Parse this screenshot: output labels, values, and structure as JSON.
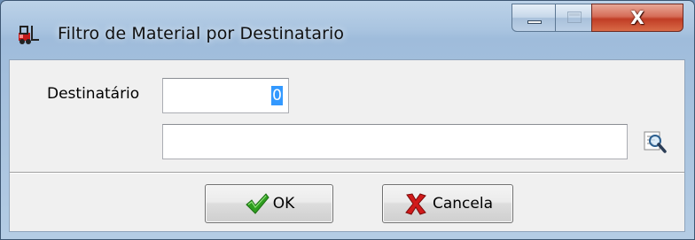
{
  "window": {
    "title": "Filtro de Material por Destinatario",
    "app_icon": "forklift-icon",
    "caption_buttons": {
      "minimize_icon": "minimize-icon",
      "maximize_icon": "maximize-icon",
      "close_label": "X"
    }
  },
  "form": {
    "destinatario_label": "Destinatário",
    "destinatario_code_value": "0",
    "destinatario_name_value": "",
    "search_icon": "magnifier-search-icon"
  },
  "buttons": {
    "ok_label": "OK",
    "ok_icon": "check-icon",
    "cancel_label": "Cancela",
    "cancel_icon": "red-x-icon"
  },
  "colors": {
    "selection": "#3399ff",
    "check_green": "#2e9e1f",
    "cancel_red": "#d11a1a",
    "close_button": "#c94a33"
  }
}
